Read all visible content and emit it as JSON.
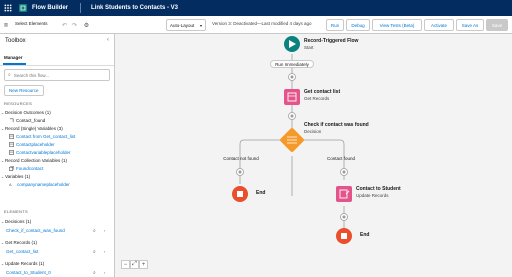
{
  "app": {
    "name": "Flow Builder",
    "flow_title": "Link Students to Contacts - V3"
  },
  "toolbar": {
    "select_elements": "Select Elements",
    "layout": "Auto-Layout",
    "status": "Version 3: Deactivated—Last modified 4 days ago",
    "run": "Run",
    "debug": "Debug",
    "view_tests": "View Tests (Beta)",
    "activate": "Activate",
    "save_as": "Save As",
    "save": "Save"
  },
  "toolbox": {
    "title": "Toolbox",
    "tab": "Manager",
    "search_placeholder": "Search this flow...",
    "new_resource": "New Resource",
    "resources_header": "RESOURCES",
    "resources": [
      {
        "label": "Decision Outcomes (1)",
        "children": [
          "Contact_found"
        ]
      },
      {
        "label": "Record (Single) Variables (3)",
        "children": [
          "Contact from Get_contact_list",
          "Contactplaceholder",
          "Contactvariableplaceholder"
        ]
      },
      {
        "label": "Record Collection Variables (1)",
        "children": [
          "Foundcontact"
        ]
      },
      {
        "label": "Variables (1)",
        "children": [
          "companynameplaceholder"
        ]
      }
    ],
    "elements_header": "ELEMENTS",
    "elements": [
      {
        "label": "Decisions (1)",
        "children": [
          "Check_if_contact_was_found"
        ]
      },
      {
        "label": "Get Records (1)",
        "children": [
          "Get_contact_list"
        ]
      },
      {
        "label": "Update Records (1)",
        "children": [
          "Contact_to_Student_0"
        ]
      }
    ]
  },
  "canvas": {
    "start_title": "Record-Triggered Flow",
    "start_sub": "Start",
    "run_immediately": "Run Immediately",
    "get_title": "Get contact list",
    "get_sub": "Get Records",
    "decision_title": "Check if contact was found",
    "decision_sub": "Decision",
    "branch_left": "Contact not found",
    "branch_right": "Contact found",
    "end_left": "End",
    "update_title": "Contact to Student",
    "update_sub": "Update Records",
    "end_right": "End"
  },
  "colors": {
    "topbar": "#032d60",
    "start": "#0b827c",
    "get": "#e4548b",
    "decision": "#f59a2a",
    "update": "#e4548b",
    "end": "#ea4e2c",
    "link": "#0176d3"
  }
}
